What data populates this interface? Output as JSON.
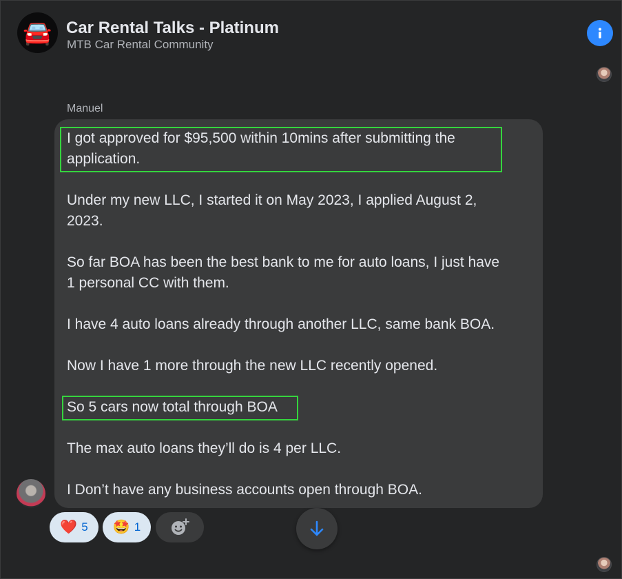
{
  "header": {
    "group_icon": "red-car-emoji",
    "group_emoji": "🚘",
    "title": "Car Rental Talks - Platinum",
    "subtitle": "MTB Car Rental Community",
    "info_icon": "info-icon"
  },
  "message": {
    "sender": "Manuel",
    "lines": [
      "I got approved for $95,500 within 10mins after submitting the",
      "application.",
      "Under my new LLC, I started it on May 2023, I applied August 2,",
      "2023.",
      "So far BOA has been the best bank to me for auto loans, I just have",
      "1 personal CC with them.",
      "I have 4 auto loans already through another LLC, same bank BOA.",
      "Now I have 1 more through the new LLC recently opened.",
      "So 5 cars now total through BOA",
      "The max auto loans they’ll do is 4 per LLC.",
      "I Don’t have any business accounts open through BOA."
    ]
  },
  "reactions": [
    {
      "icon": "heart-icon",
      "emoji": "❤️",
      "count": "5"
    },
    {
      "icon": "star-struck-face-icon",
      "emoji": "🤩",
      "count": "1"
    },
    {
      "icon": "add-reaction-icon",
      "emoji": "",
      "count": ""
    }
  ],
  "colors": {
    "background": "#242526",
    "bubble": "#3a3b3c",
    "text": "#e4e6eb",
    "secondary_text": "#b0b3b8",
    "accent": "#2d88ff",
    "highlight": "#35d43e"
  }
}
